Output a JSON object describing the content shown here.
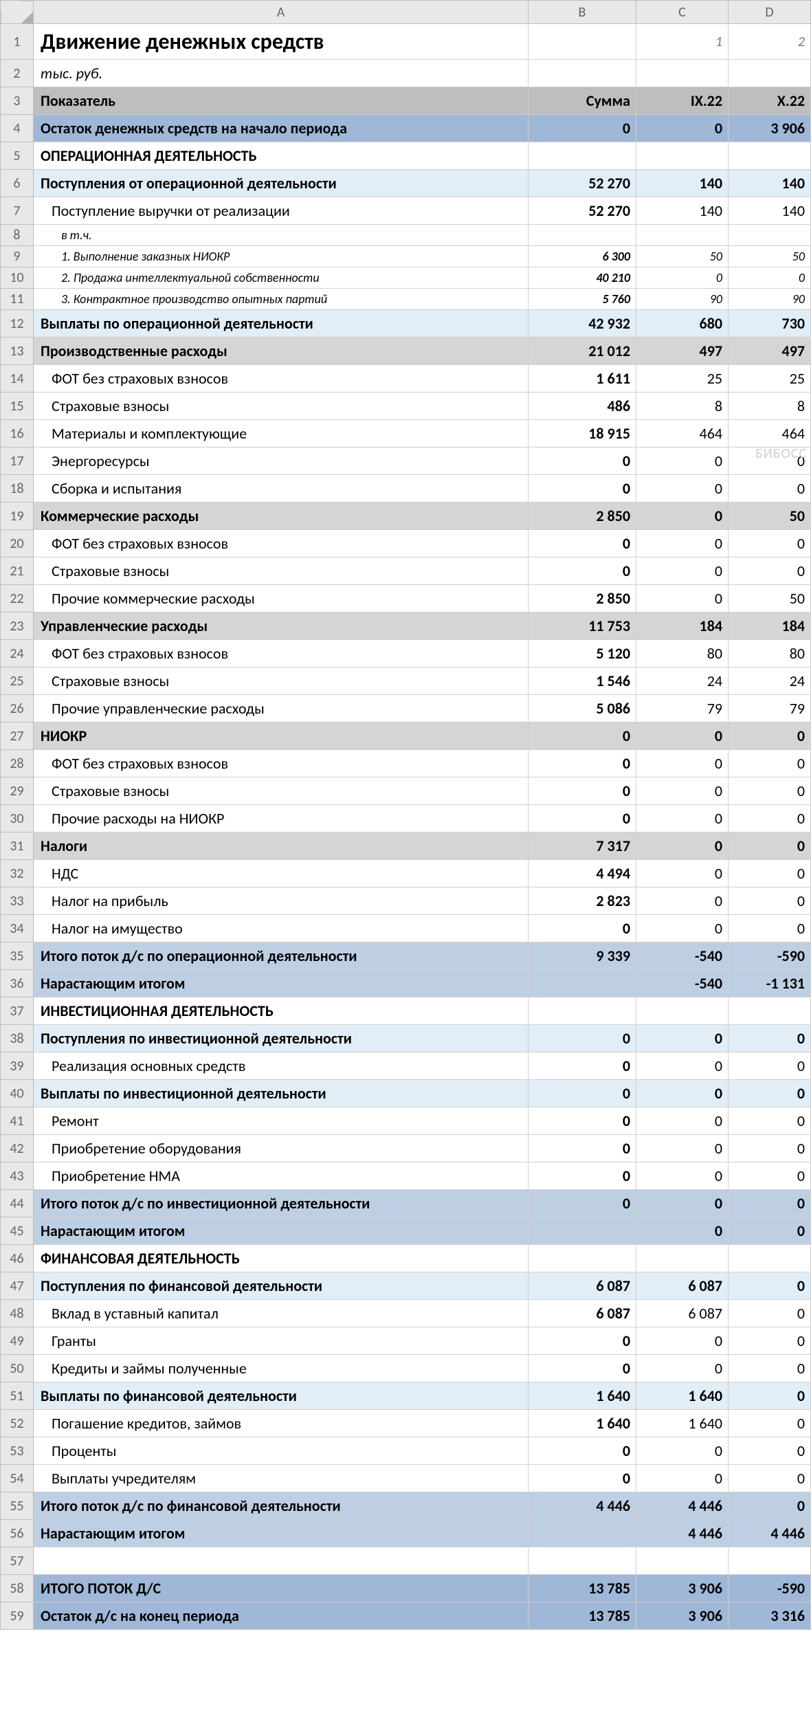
{
  "column_headers": [
    "A",
    "B",
    "C",
    "D"
  ],
  "watermark": "БИБОСС",
  "chart_data": {
    "type": "table",
    "title": "Движение денежных средств",
    "subtitle": "тыс. руб.",
    "header_row": [
      "Показатель",
      "Сумма",
      "IX.22",
      "X.22"
    ],
    "top_labels_cd": [
      "1",
      "2"
    ],
    "rows": [
      {
        "label": "Остаток денежных средств на начало периода",
        "b": "0",
        "c": "0",
        "d": "3 906"
      },
      {
        "label": "ОПЕРАЦИОННАЯ ДЕЯТЕЛЬНОСТЬ"
      },
      {
        "label": "Поступления от операционной деятельности",
        "b": "52 270",
        "c": "140",
        "d": "140"
      },
      {
        "label": "Поступление выручки от реализации",
        "b": "52 270",
        "c": "140",
        "d": "140"
      },
      {
        "label": "в т.ч."
      },
      {
        "label": "1. Выполнение заказных НИОКР",
        "b": "6 300",
        "c": "50",
        "d": "50"
      },
      {
        "label": "2. Продажа интеллектуальной собственности",
        "b": "40 210",
        "c": "0",
        "d": "0"
      },
      {
        "label": "3. Контрактное производство опытных партий",
        "b": "5 760",
        "c": "90",
        "d": "90"
      },
      {
        "label": "Выплаты по операционной деятельности",
        "b": "42 932",
        "c": "680",
        "d": "730"
      },
      {
        "label": "Производственные расходы",
        "b": "21 012",
        "c": "497",
        "d": "497"
      },
      {
        "label": "ФОТ без страховых взносов",
        "b": "1 611",
        "c": "25",
        "d": "25"
      },
      {
        "label": "Страховые взносы",
        "b": "486",
        "c": "8",
        "d": "8"
      },
      {
        "label": "Материалы и комплектующие",
        "b": "18 915",
        "c": "464",
        "d": "464"
      },
      {
        "label": "Энергоресурсы",
        "b": "0",
        "c": "0",
        "d": "0"
      },
      {
        "label": "Сборка и испытания",
        "b": "0",
        "c": "0",
        "d": "0"
      },
      {
        "label": "Коммерческие расходы",
        "b": "2 850",
        "c": "0",
        "d": "50"
      },
      {
        "label": "ФОТ без страховых взносов",
        "b": "0",
        "c": "0",
        "d": "0"
      },
      {
        "label": "Страховые взносы",
        "b": "0",
        "c": "0",
        "d": "0"
      },
      {
        "label": "Прочие коммерческие расходы",
        "b": "2 850",
        "c": "0",
        "d": "50"
      },
      {
        "label": "Управленческие расходы",
        "b": "11 753",
        "c": "184",
        "d": "184"
      },
      {
        "label": "ФОТ без страховых взносов",
        "b": "5 120",
        "c": "80",
        "d": "80"
      },
      {
        "label": "Страховые взносы",
        "b": "1 546",
        "c": "24",
        "d": "24"
      },
      {
        "label": "Прочие управленческие расходы",
        "b": "5 086",
        "c": "79",
        "d": "79"
      },
      {
        "label": "НИОКР",
        "b": "0",
        "c": "0",
        "d": "0"
      },
      {
        "label": "ФОТ без страховых взносов",
        "b": "0",
        "c": "0",
        "d": "0"
      },
      {
        "label": "Страховые взносы",
        "b": "0",
        "c": "0",
        "d": "0"
      },
      {
        "label": "Прочие расходы на НИОКР",
        "b": "0",
        "c": "0",
        "d": "0"
      },
      {
        "label": "Налоги",
        "b": "7 317",
        "c": "0",
        "d": "0"
      },
      {
        "label": "НДС",
        "b": "4 494",
        "c": "0",
        "d": "0"
      },
      {
        "label": "Налог на прибыль",
        "b": "2 823",
        "c": "0",
        "d": "0"
      },
      {
        "label": "Налог на имущество",
        "b": "0",
        "c": "0",
        "d": "0"
      },
      {
        "label": "Итого поток д/с по операционной деятельности",
        "b": "9 339",
        "c": "-540",
        "d": "-590"
      },
      {
        "label": "Нарастающим итогом",
        "b": "",
        "c": "-540",
        "d": "-1 131"
      },
      {
        "label": "ИНВЕСТИЦИОННАЯ ДЕЯТЕЛЬНОСТЬ"
      },
      {
        "label": "Поступления по инвестиционной деятельности",
        "b": "0",
        "c": "0",
        "d": "0"
      },
      {
        "label": "Реализация основных средств",
        "b": "0",
        "c": "0",
        "d": "0"
      },
      {
        "label": "Выплаты по инвестиционной деятельности",
        "b": "0",
        "c": "0",
        "d": "0"
      },
      {
        "label": "Ремонт",
        "b": "0",
        "c": "0",
        "d": "0"
      },
      {
        "label": "Приобретение оборудования",
        "b": "0",
        "c": "0",
        "d": "0"
      },
      {
        "label": "Приобретение НМА",
        "b": "0",
        "c": "0",
        "d": "0"
      },
      {
        "label": "Итого поток д/с по инвестиционной деятельности",
        "b": "0",
        "c": "0",
        "d": "0"
      },
      {
        "label": "Нарастающим итогом",
        "b": "",
        "c": "0",
        "d": "0"
      },
      {
        "label": "ФИНАНСОВАЯ ДЕЯТЕЛЬНОСТЬ"
      },
      {
        "label": "Поступления по финансовой деятельности",
        "b": "6 087",
        "c": "6 087",
        "d": "0"
      },
      {
        "label": "Вклад в уставный капитал",
        "b": "6 087",
        "c": "6 087",
        "d": "0"
      },
      {
        "label": "Гранты",
        "b": "0",
        "c": "0",
        "d": "0"
      },
      {
        "label": "Кредиты и займы полученные",
        "b": "0",
        "c": "0",
        "d": "0"
      },
      {
        "label": "Выплаты по финансовой деятельности",
        "b": "1 640",
        "c": "1 640",
        "d": "0"
      },
      {
        "label": "Погашение кредитов, займов",
        "b": "1 640",
        "c": "1 640",
        "d": "0"
      },
      {
        "label": "Проценты",
        "b": "0",
        "c": "0",
        "d": "0"
      },
      {
        "label": "Выплаты учредителям",
        "b": "0",
        "c": "0",
        "d": "0"
      },
      {
        "label": "Итого поток д/с по финансовой деятельности",
        "b": "4 446",
        "c": "4 446",
        "d": "0"
      },
      {
        "label": "Нарастающим итогом",
        "b": "",
        "c": "4 446",
        "d": "4 446"
      },
      {
        "label": ""
      },
      {
        "label": "ИТОГО ПОТОК Д/С",
        "b": "13 785",
        "c": "3 906",
        "d": "-590"
      },
      {
        "label": "Остаток д/с на конец периода",
        "b": "13 785",
        "c": "3 906",
        "d": "3 316"
      }
    ]
  },
  "layout": [
    {
      "n": 1,
      "kind": "title",
      "hcls": "h-big"
    },
    {
      "n": 2,
      "kind": "subtitle"
    },
    {
      "n": 3,
      "kind": "header",
      "cls": "fill-gray-hdr"
    },
    {
      "n": 4,
      "r": 0,
      "cls": "fill-blue1",
      "bold": true
    },
    {
      "n": 5,
      "r": 1,
      "bold": true
    },
    {
      "n": 6,
      "r": 2,
      "cls": "fill-blue2",
      "bold": true
    },
    {
      "n": 7,
      "r": 3,
      "indent": 1,
      "boldB": true
    },
    {
      "n": 8,
      "r": 4,
      "indent": 2,
      "ital": true,
      "hcls": "h-sm",
      "small": true
    },
    {
      "n": 9,
      "r": 5,
      "indent": 2,
      "ital": true,
      "hcls": "h-sm",
      "small": true,
      "boldB": true
    },
    {
      "n": 10,
      "r": 6,
      "indent": 2,
      "ital": true,
      "hcls": "h-sm",
      "small": true,
      "boldB": true
    },
    {
      "n": 11,
      "r": 7,
      "indent": 2,
      "ital": true,
      "hcls": "h-sm",
      "small": true,
      "boldB": true
    },
    {
      "n": 12,
      "r": 8,
      "cls": "fill-blue2",
      "bold": true
    },
    {
      "n": 13,
      "r": 9,
      "cls": "fill-gray",
      "bold": true
    },
    {
      "n": 14,
      "r": 10,
      "indent": 1,
      "boldB": true
    },
    {
      "n": 15,
      "r": 11,
      "indent": 1,
      "boldB": true
    },
    {
      "n": 16,
      "r": 12,
      "indent": 1,
      "boldB": true
    },
    {
      "n": 17,
      "r": 13,
      "indent": 1,
      "boldB": true
    },
    {
      "n": 18,
      "r": 14,
      "indent": 1,
      "boldB": true
    },
    {
      "n": 19,
      "r": 15,
      "cls": "fill-gray",
      "bold": true
    },
    {
      "n": 20,
      "r": 16,
      "indent": 1,
      "boldB": true
    },
    {
      "n": 21,
      "r": 17,
      "indent": 1,
      "boldB": true
    },
    {
      "n": 22,
      "r": 18,
      "indent": 1,
      "boldB": true
    },
    {
      "n": 23,
      "r": 19,
      "cls": "fill-gray",
      "bold": true
    },
    {
      "n": 24,
      "r": 20,
      "indent": 1,
      "boldB": true
    },
    {
      "n": 25,
      "r": 21,
      "indent": 1,
      "boldB": true
    },
    {
      "n": 26,
      "r": 22,
      "indent": 1,
      "boldB": true
    },
    {
      "n": 27,
      "r": 23,
      "cls": "fill-gray",
      "bold": true
    },
    {
      "n": 28,
      "r": 24,
      "indent": 1,
      "boldB": true
    },
    {
      "n": 29,
      "r": 25,
      "indent": 1,
      "boldB": true
    },
    {
      "n": 30,
      "r": 26,
      "indent": 1,
      "boldB": true
    },
    {
      "n": 31,
      "r": 27,
      "cls": "fill-gray",
      "bold": true
    },
    {
      "n": 32,
      "r": 28,
      "indent": 1,
      "boldB": true
    },
    {
      "n": 33,
      "r": 29,
      "indent": 1,
      "boldB": true
    },
    {
      "n": 34,
      "r": 30,
      "indent": 1,
      "boldB": true
    },
    {
      "n": 35,
      "r": 31,
      "cls": "fill-blue3",
      "bold": true
    },
    {
      "n": 36,
      "r": 32,
      "cls": "fill-blue3",
      "bold": true
    },
    {
      "n": 37,
      "r": 33,
      "bold": true
    },
    {
      "n": 38,
      "r": 34,
      "cls": "fill-blue2",
      "bold": true
    },
    {
      "n": 39,
      "r": 35,
      "indent": 1,
      "boldB": true
    },
    {
      "n": 40,
      "r": 36,
      "cls": "fill-blue2",
      "bold": true
    },
    {
      "n": 41,
      "r": 37,
      "indent": 1,
      "boldB": true
    },
    {
      "n": 42,
      "r": 38,
      "indent": 1,
      "boldB": true
    },
    {
      "n": 43,
      "r": 39,
      "indent": 1,
      "boldB": true
    },
    {
      "n": 44,
      "r": 40,
      "cls": "fill-blue3",
      "bold": true
    },
    {
      "n": 45,
      "r": 41,
      "cls": "fill-blue3",
      "bold": true
    },
    {
      "n": 46,
      "r": 42,
      "bold": true
    },
    {
      "n": 47,
      "r": 43,
      "cls": "fill-blue2",
      "bold": true
    },
    {
      "n": 48,
      "r": 44,
      "indent": 1,
      "boldB": true
    },
    {
      "n": 49,
      "r": 45,
      "indent": 1,
      "boldB": true
    },
    {
      "n": 50,
      "r": 46,
      "indent": 1,
      "boldB": true
    },
    {
      "n": 51,
      "r": 47,
      "cls": "fill-blue2",
      "bold": true
    },
    {
      "n": 52,
      "r": 48,
      "indent": 1,
      "boldB": true
    },
    {
      "n": 53,
      "r": 49,
      "indent": 1,
      "boldB": true
    },
    {
      "n": 54,
      "r": 50,
      "indent": 1,
      "boldB": true
    },
    {
      "n": 55,
      "r": 51,
      "cls": "fill-blue3",
      "bold": true
    },
    {
      "n": 56,
      "r": 52,
      "cls": "fill-blue3",
      "bold": true
    },
    {
      "n": 57,
      "r": 53
    },
    {
      "n": 58,
      "r": 54,
      "cls": "fill-blue1",
      "bold": true
    },
    {
      "n": 59,
      "r": 55,
      "cls": "fill-blue1",
      "bold": true
    }
  ]
}
